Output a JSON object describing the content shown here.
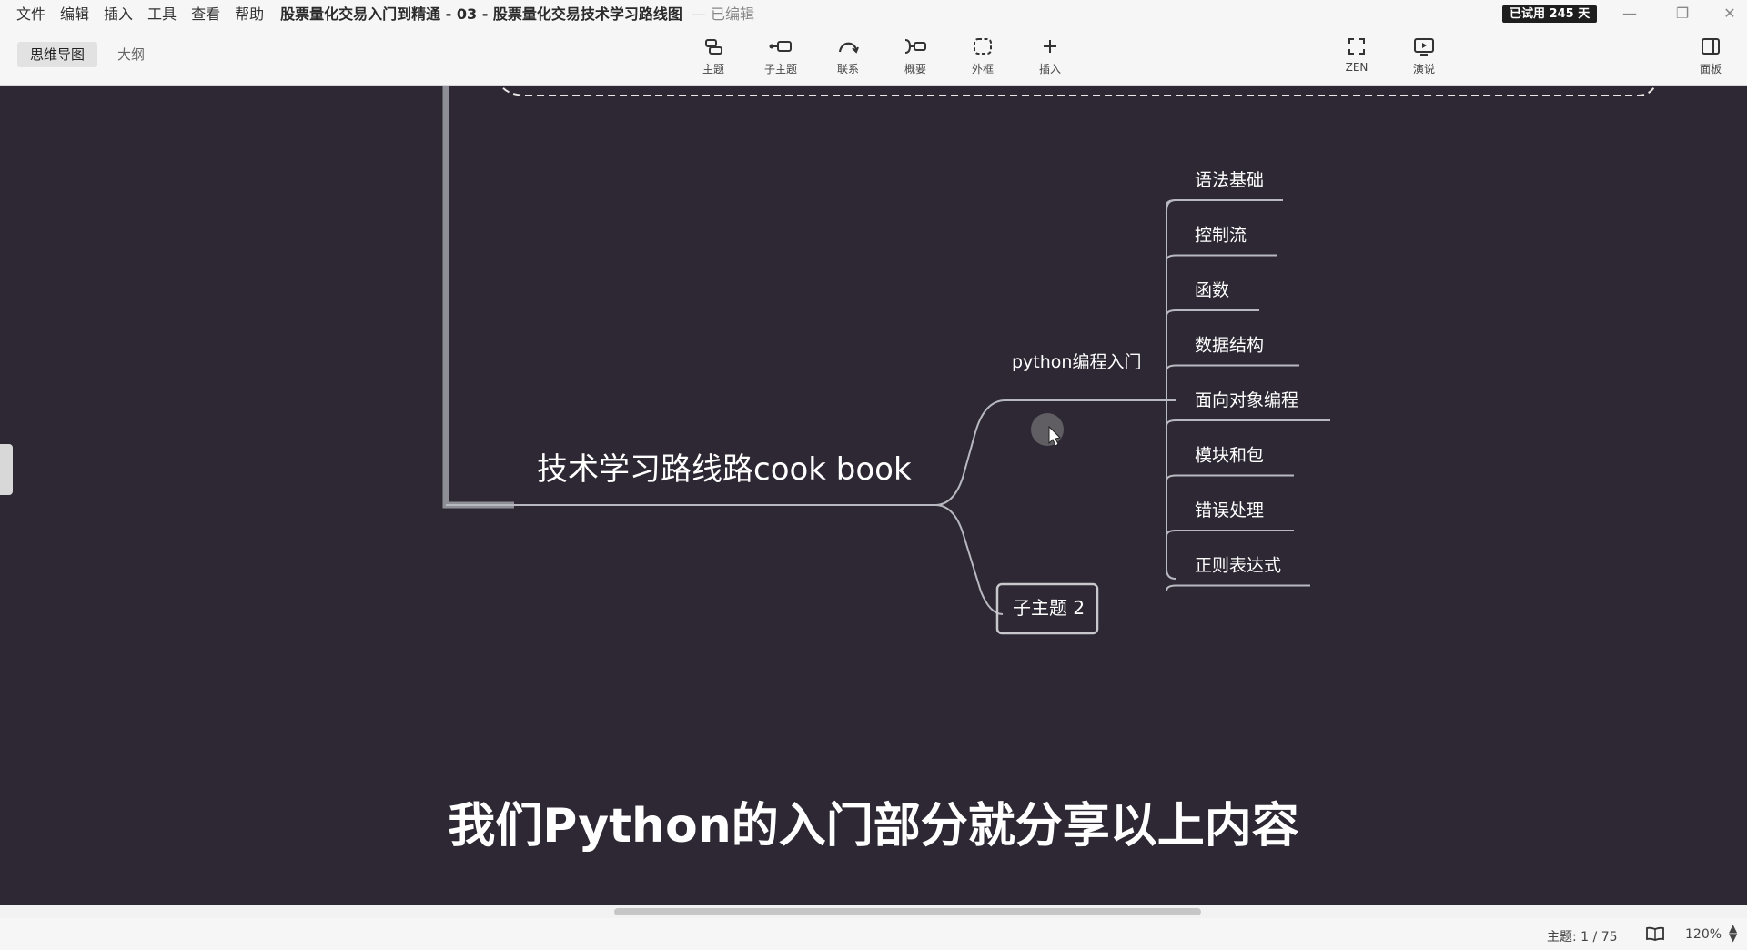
{
  "menubar": {
    "items": [
      "文件",
      "编辑",
      "插入",
      "工具",
      "查看",
      "帮助"
    ],
    "doc_title": "股票量化交易入门到精通 - 03 - 股票量化交易技术学习路线图",
    "doc_status": "— 已编辑",
    "trial_badge": "已试用 245 天"
  },
  "toolbar": {
    "view_tabs": [
      "思维导图",
      "大纲"
    ],
    "tools": [
      {
        "label": "主题",
        "icon": "topic-icon"
      },
      {
        "label": "子主题",
        "icon": "subtopic-icon"
      },
      {
        "label": "联系",
        "icon": "relationship-icon"
      },
      {
        "label": "概要",
        "icon": "summary-icon"
      },
      {
        "label": "外框",
        "icon": "boundary-icon"
      },
      {
        "label": "插入",
        "icon": "plus-icon"
      }
    ],
    "right_tools": [
      {
        "label": "ZEN",
        "icon": "fullscreen-icon"
      },
      {
        "label": "演说",
        "icon": "present-icon"
      },
      {
        "label": "面板",
        "icon": "panel-icon"
      }
    ]
  },
  "mindmap": {
    "main_topic": "技术学习路线路cook book",
    "branch_python": "python编程入门",
    "python_children": [
      "语法基础",
      "控制流",
      "函数",
      "数据结构",
      "面向对象编程",
      "模块和包",
      "错误处理",
      "正则表达式"
    ],
    "subtopic_2": "子主题 2",
    "colors": {
      "canvas": "#2d2833",
      "line": "#b8b8c0",
      "trunk": "#8e8f96"
    }
  },
  "subtitle": "我们Python的入门部分就分享以上内容",
  "status": {
    "topic_count": "主题: 1 / 75",
    "zoom": "120%"
  }
}
